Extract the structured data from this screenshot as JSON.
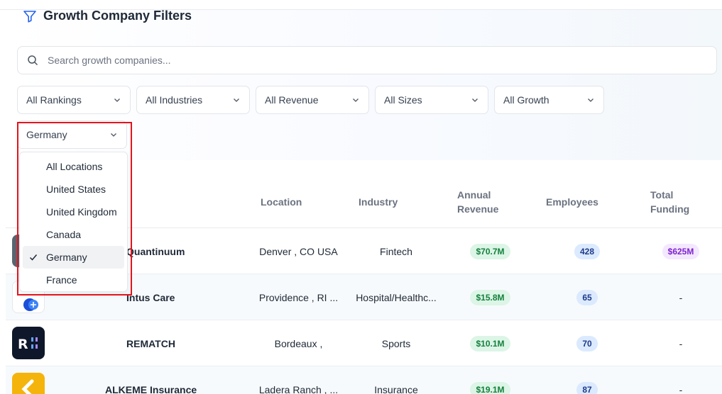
{
  "filters": {
    "title": "Growth Company Filters",
    "search_placeholder": "Search growth companies...",
    "selects": [
      {
        "label": "All Rankings"
      },
      {
        "label": "All Industries"
      },
      {
        "label": "All Revenue"
      },
      {
        "label": "All Sizes"
      },
      {
        "label": "All Growth"
      }
    ],
    "location": {
      "value": "Germany",
      "options": [
        "All Locations",
        "United States",
        "United Kingdom",
        "Canada",
        "Germany",
        "France"
      ],
      "selected_index": 4
    }
  },
  "table": {
    "headers": {
      "location": "Location",
      "industry": "Industry",
      "revenue_line1": "Annual",
      "revenue_line2": "Revenue",
      "employees": "Employees",
      "funding_line1": "Total",
      "funding_line2": "Funding"
    },
    "rows": [
      {
        "name": "Quantinuum",
        "location": "Denver , CO USA",
        "industry": "Fintech",
        "revenue": "$70.7M",
        "employees": "428",
        "funding": "$625M"
      },
      {
        "name": "Intus Care",
        "location": "Providence , RI ...",
        "industry": "Hospital/Healthc...",
        "revenue": "$15.8M",
        "employees": "65",
        "funding": "-"
      },
      {
        "name": "REMATCH",
        "location": "Bordeaux ,",
        "industry": "Sports",
        "revenue": "$10.1M",
        "employees": "70",
        "funding": "-"
      },
      {
        "name": "ALKEME Insurance",
        "location": "Ladera Ranch , ...",
        "industry": "Insurance",
        "revenue": "$19.1M",
        "employees": "87",
        "funding": "-"
      }
    ]
  },
  "colors": {
    "accent": "#2563eb",
    "highlight": "#e3141d"
  }
}
